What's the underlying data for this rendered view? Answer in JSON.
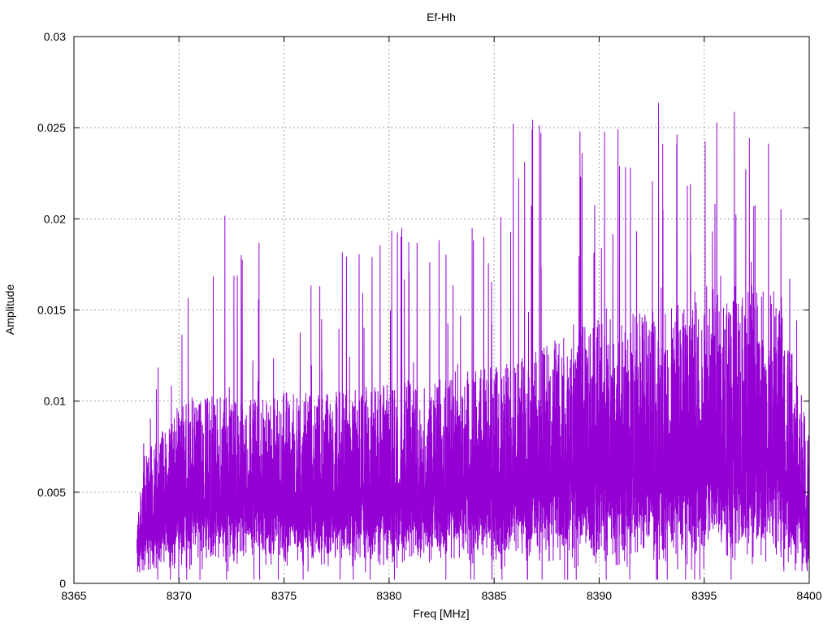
{
  "chart_data": {
    "type": "line",
    "title": "Ef-Hh",
    "xlabel": "Freq [MHz]",
    "ylabel": "Amplitude",
    "xlim": [
      8365,
      8400
    ],
    "ylim": [
      0,
      0.03
    ],
    "x_ticks": [
      "8365",
      "8370",
      "8375",
      "8380",
      "8385",
      "8390",
      "8395",
      "8400"
    ],
    "y_ticks": [
      "0",
      "0.005",
      "0.01",
      "0.015",
      "0.02",
      "0.025",
      "0.03"
    ],
    "grid": true,
    "series_color": "#9400d3",
    "envelope": {
      "x": [
        8368.0,
        8368.3,
        8369.0,
        8370.0,
        8371.0,
        8373.0,
        8375.0,
        8377.5,
        8380.0,
        8382.5,
        8385.0,
        8386.3,
        8388.0,
        8390.0,
        8392.5,
        8395.0,
        8397.0,
        8398.5,
        8399.5,
        8400.0
      ],
      "upper": [
        0.004,
        0.008,
        0.012,
        0.016,
        0.0225,
        0.019,
        0.02,
        0.018,
        0.02,
        0.019,
        0.02,
        0.0275,
        0.025,
        0.0255,
        0.0265,
        0.026,
        0.027,
        0.0245,
        0.015,
        0.01
      ],
      "typical_high": [
        0.003,
        0.007,
        0.008,
        0.01,
        0.0105,
        0.01,
        0.0105,
        0.0105,
        0.011,
        0.0115,
        0.012,
        0.0125,
        0.0135,
        0.0145,
        0.015,
        0.0155,
        0.017,
        0.016,
        0.011,
        0.008
      ],
      "typical_low": [
        0.001,
        0.0015,
        0.002,
        0.0025,
        0.0025,
        0.0025,
        0.0025,
        0.0025,
        0.0025,
        0.0025,
        0.0025,
        0.003,
        0.003,
        0.003,
        0.003,
        0.003,
        0.003,
        0.003,
        0.002,
        0.001
      ]
    }
  }
}
